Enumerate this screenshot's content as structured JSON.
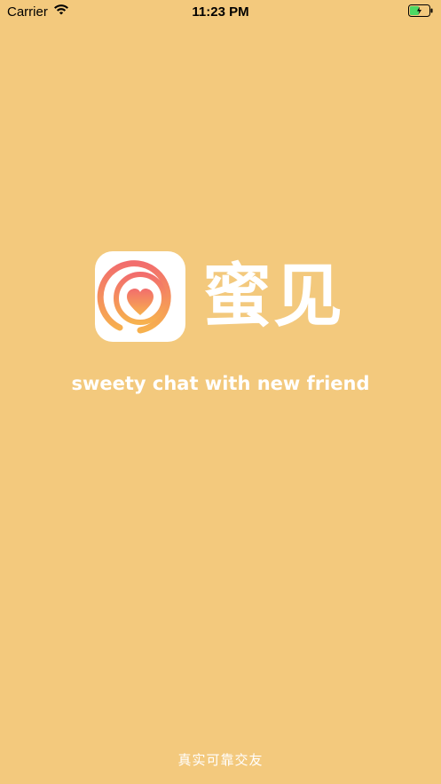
{
  "status_bar": {
    "carrier": "Carrier",
    "time": "11:23 PM",
    "wifi_icon": "wifi-icon",
    "battery_icon": "battery-charging-icon"
  },
  "splash": {
    "app_name": "蜜见",
    "tagline": "sweety chat with new friend",
    "footer": "真实可靠交友",
    "logo_icon": "heart-logo-icon"
  },
  "colors": {
    "background": "#F3C97D",
    "logo_gradient_start": "#F26D6D",
    "logo_gradient_end": "#F7B14E",
    "text": "#FFFFFF",
    "battery_fill": "#4CD964"
  }
}
